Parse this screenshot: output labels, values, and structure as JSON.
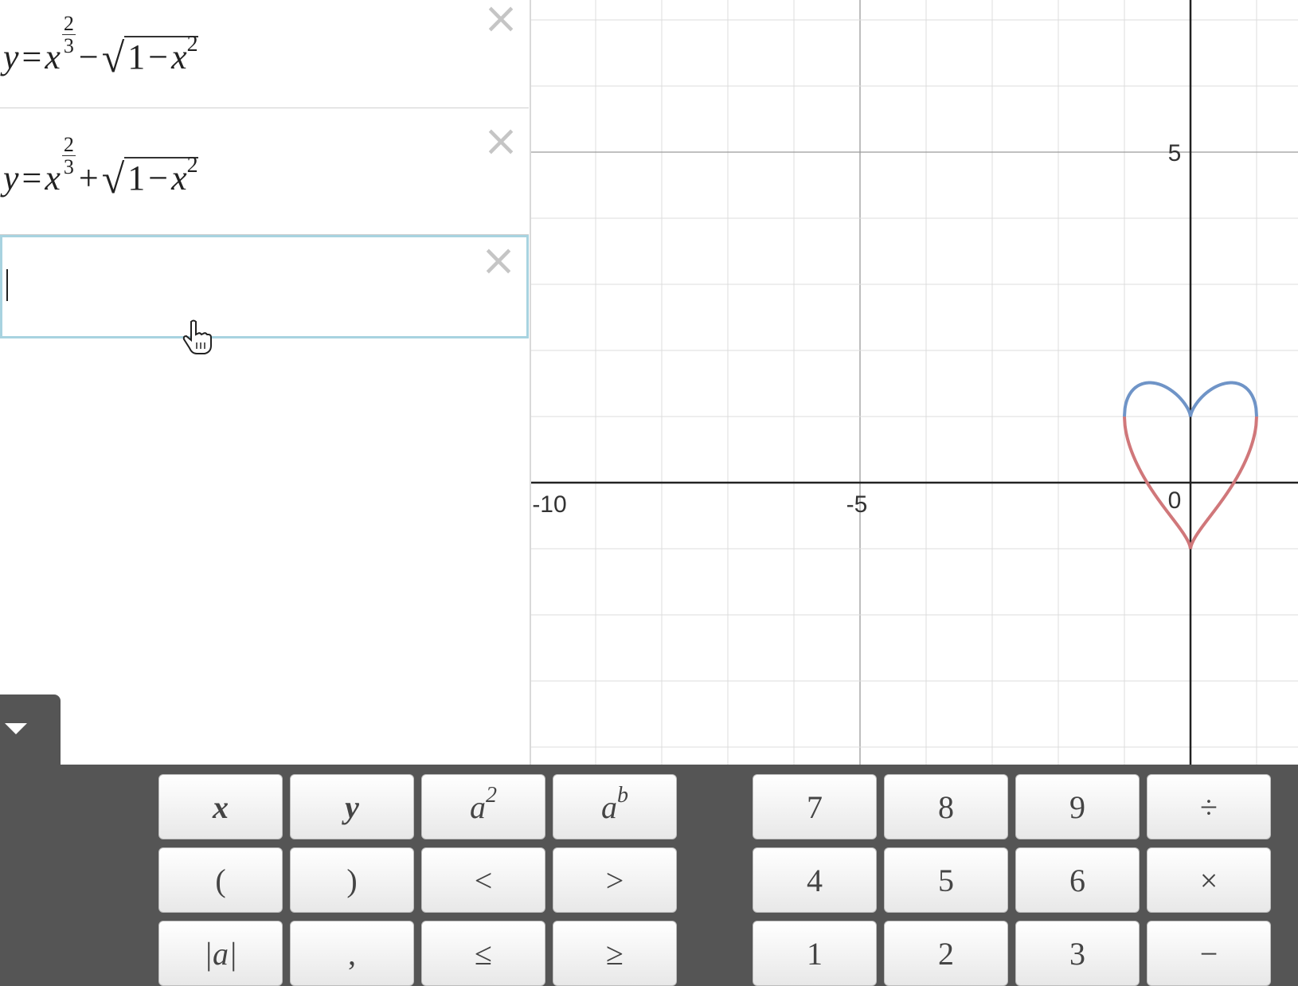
{
  "expressions": [
    {
      "lhs": "y",
      "eq": "=",
      "base": "x",
      "exp_num": "2",
      "exp_den": "3",
      "op": "−",
      "sqrt_sym": "√",
      "rad_a": "1",
      "rad_op": "−",
      "rad_b": "x",
      "rad_exp": "2",
      "color": "#c74440"
    },
    {
      "lhs": "y",
      "eq": "=",
      "base": "x",
      "exp_num": "2",
      "exp_den": "3",
      "op": "+",
      "sqrt_sym": "√",
      "rad_a": "1",
      "rad_op": "−",
      "rad_b": "x",
      "rad_exp": "2",
      "color": "#2d70b3"
    }
  ],
  "active_expression": {
    "value": ""
  },
  "close_icon": "×",
  "graph": {
    "x_labels": [
      "-10",
      "-5",
      "0"
    ],
    "y_labels": [
      "5"
    ],
    "x_range": [
      -10,
      1.6
    ],
    "y_range": [
      -4.2,
      7.3
    ],
    "grid": true,
    "curve_colors": {
      "upper": "#6f94c7",
      "lower": "#d0777a"
    }
  },
  "keypad": {
    "left_rows": [
      [
        "x",
        "y",
        "a2",
        "ab"
      ],
      [
        "(",
        ")",
        "<",
        ">"
      ],
      [
        "|a|",
        ",",
        "≤",
        "≥"
      ]
    ],
    "right_rows": [
      [
        "7",
        "8",
        "9",
        "÷"
      ],
      [
        "4",
        "5",
        "6",
        "×"
      ],
      [
        "1",
        "2",
        "3",
        "−"
      ]
    ],
    "labels": {
      "x": "x",
      "y": "y",
      "a2_base": "a",
      "a2_exp": "2",
      "ab_base": "a",
      "ab_exp": "b"
    }
  },
  "colors": {
    "keypad_bg": "#555555",
    "active_border": "#a8d3e0"
  }
}
